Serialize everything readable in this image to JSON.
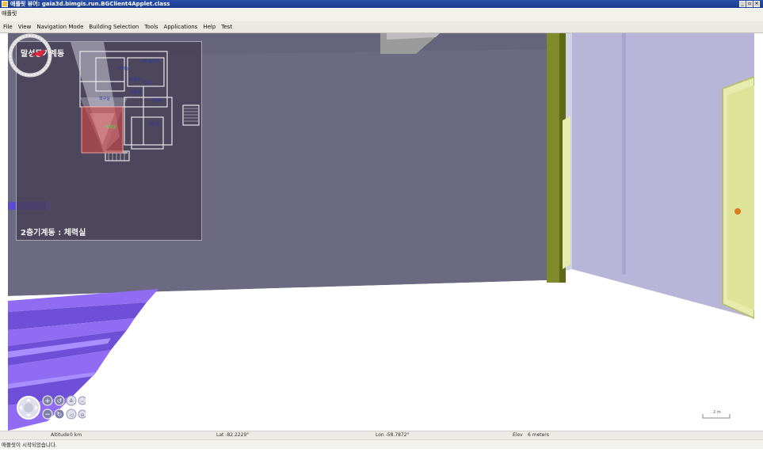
{
  "window": {
    "title": "애플릿 뷰어: gaia3d.bimgis.run.BGClient4Applet.class",
    "applet_label": "애플릿"
  },
  "menu": [
    "File",
    "View",
    "Navigation Mode",
    "Building Selection",
    "Tools",
    "Applications",
    "Help",
    "Test"
  ],
  "minimap": {
    "title": "말성동기계동",
    "location": "2층기계동 : 체력실",
    "rooms": [
      {
        "id": "r1",
        "label": "사무실/관리"
      },
      {
        "id": "r2",
        "label": "회의실"
      },
      {
        "id": "r3",
        "label": "휴게실"
      },
      {
        "id": "r4",
        "label": "창고"
      },
      {
        "id": "r5",
        "label": "학구실"
      },
      {
        "id": "r6",
        "label": "화장실"
      },
      {
        "id": "r7",
        "label": "전산실"
      },
      {
        "id": "r8",
        "label": "체력실",
        "current": true
      },
      {
        "id": "r9",
        "label": "강당실"
      }
    ]
  },
  "scale": {
    "label": "2 m"
  },
  "status": {
    "altitude_label": "Altitude",
    "altitude_value": "0 km",
    "lat": "Lat -82.2229°",
    "lon": "Lon -58.7872°",
    "elev_label": "Elev",
    "elev_value": "6 meters"
  },
  "message": "애플릿이 시작되었습니다.",
  "icons": {
    "compass": "compass-icon",
    "pan": "pan-control-icon",
    "zoom_in": "zoom-in-icon",
    "zoom_out": "zoom-out-icon",
    "rotate_ccw": "rotate-ccw-icon",
    "rotate_cw": "rotate-cw-icon",
    "tilt_up": "tilt-up-icon",
    "tilt_down": "tilt-down-icon",
    "look": "look-icon",
    "walk": "walk-icon"
  },
  "colors": {
    "back_wall": "#6b6a80",
    "right_wall": "#b7b5d8",
    "floor": "#ffffff",
    "pillar": "#7f8a2a",
    "door": "#e6ecad",
    "stairs": "#8f6cf2",
    "title_bar": "#2a4fa8",
    "compass_needle": "#e0263b"
  }
}
